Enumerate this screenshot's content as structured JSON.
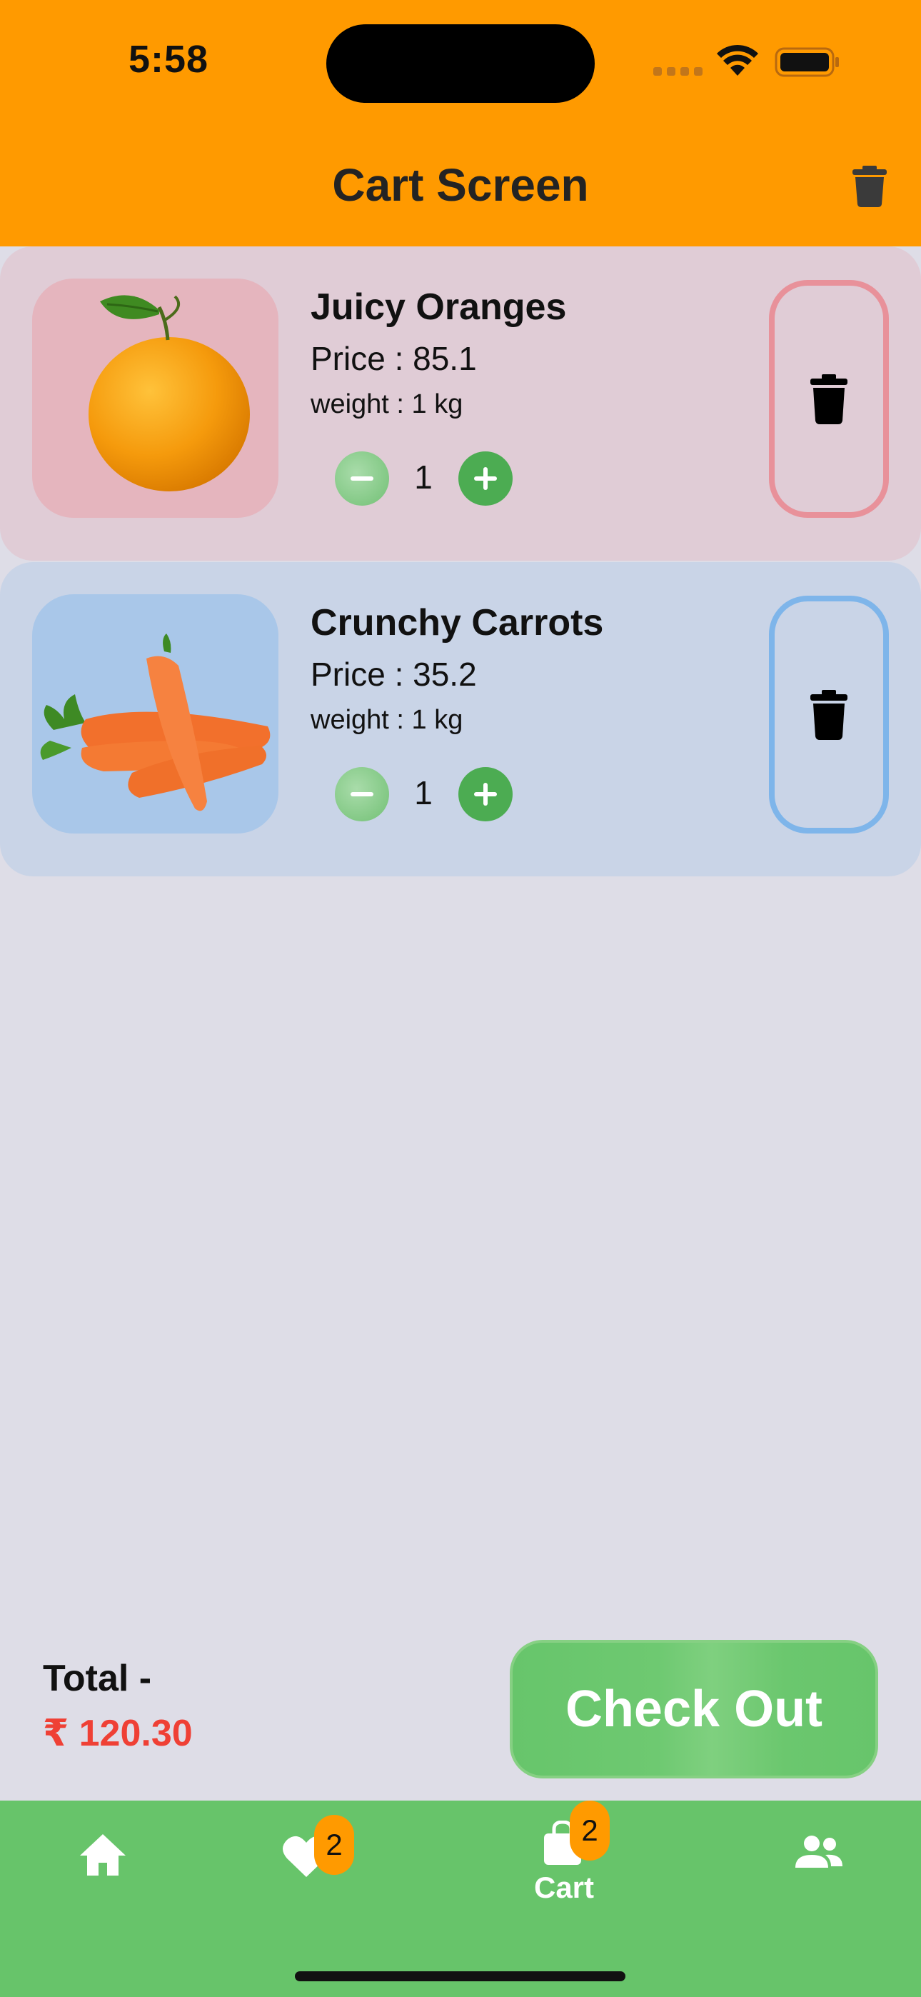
{
  "status_bar": {
    "time": "5:58",
    "icons": [
      "signal-icon",
      "wifi-icon",
      "battery-icon"
    ]
  },
  "header": {
    "title": "Cart Screen",
    "clear_icon": "trash-icon",
    "background": "#ff9a00"
  },
  "cart": {
    "items": [
      {
        "name": "Juicy Oranges",
        "price": "Price : 85.1",
        "weight": "weight : 1 kg",
        "quantity": "1",
        "image": "orange-image",
        "card_color": "#e0ccd6",
        "accent_color": "#e8919a"
      },
      {
        "name": "Crunchy Carrots",
        "price": "Price : 35.2",
        "weight": "weight : 1 kg",
        "quantity": "1",
        "image": "carrots-image",
        "card_color": "#c9d4e7",
        "accent_color": "#7eb5ea"
      }
    ]
  },
  "summary": {
    "total_label": "Total -",
    "total_value": "₹ 120.30",
    "total_color": "#ef4035",
    "checkout_label": "Check Out"
  },
  "bottom_nav": {
    "background": "#67c46a",
    "items": [
      {
        "icon": "home-icon"
      },
      {
        "icon": "heart-icon",
        "badge": "2"
      },
      {
        "icon": "shopping-bag-icon",
        "label": "Cart",
        "badge": "2"
      },
      {
        "icon": "people-icon"
      }
    ]
  }
}
